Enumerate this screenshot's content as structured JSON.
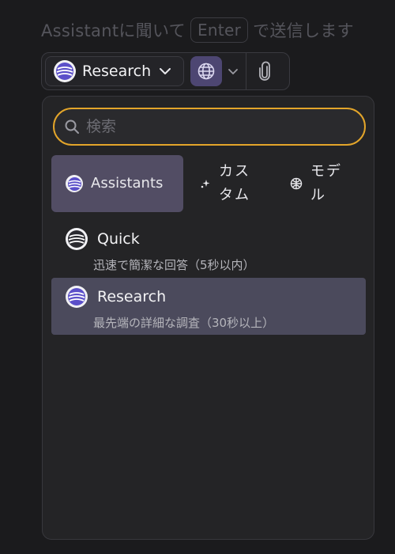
{
  "hint": {
    "before": "Assistantに聞いて",
    "key": "Enter",
    "after": "で送信します"
  },
  "toolbar": {
    "model_label": "Research",
    "icons": [
      "assistant-logo",
      "chevron-down",
      "globe",
      "chevron-down",
      "paperclip"
    ]
  },
  "search": {
    "placeholder": "検索",
    "value": ""
  },
  "tabs": [
    {
      "label": "Assistants",
      "icon": "assistant-logo",
      "active": true
    },
    {
      "label": "カスタム",
      "icon": "sparkle",
      "active": false
    },
    {
      "label": "モデル",
      "icon": "model",
      "active": false
    }
  ],
  "items": [
    {
      "title": "Quick",
      "description": "迅速で簡潔な回答（5秒以内）",
      "selected": false
    },
    {
      "title": "Research",
      "description": "最先端の詳細な調査（30秒以上）",
      "selected": true
    }
  ],
  "colors": {
    "background": "#1b1b1d",
    "panel": "#242426",
    "search_border": "#e3a52a",
    "active_tab": "#524d64",
    "selected_item": "#4b4a5c",
    "globe_button": "#4d4672",
    "research_logo": "#5b4fc9"
  }
}
